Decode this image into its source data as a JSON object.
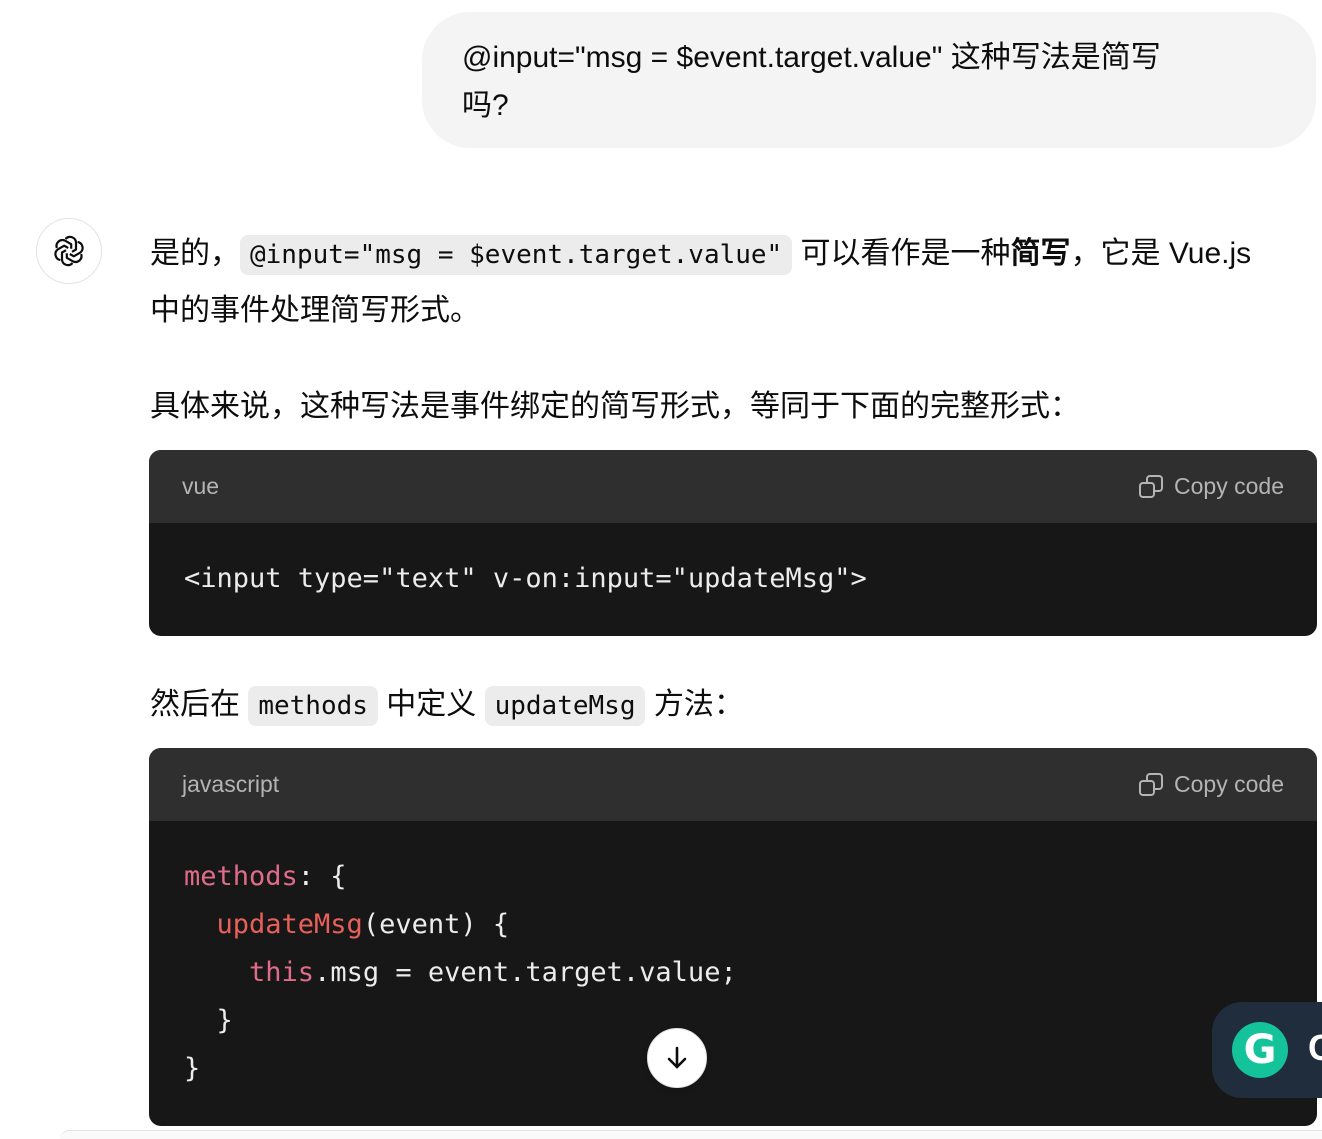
{
  "user_message": {
    "line1": "@input=\"msg = $event.target.value\" 这种写法是简写",
    "line2": "吗?"
  },
  "assistant": {
    "avatar_icon": "openai-logo-icon",
    "p1": {
      "prefix": "是的，",
      "code": "@input=\"msg = $event.target.value\"",
      "mid": " 可以看作是一种",
      "bold": "简写",
      "suffix": "，它是 Vue.js 中的事件处理简写形式。"
    },
    "p2": "具体来说，这种写法是事件绑定的简写形式，等同于下面的完整形式：",
    "code_block_1": {
      "language": "vue",
      "copy_label": "Copy code",
      "code": "<input type=\"text\" v-on:input=\"updateMsg\">"
    },
    "p3": {
      "prefix": "然后在 ",
      "code1": "methods",
      "mid": " 中定义 ",
      "code2": "updateMsg",
      "suffix": " 方法："
    },
    "code_block_2": {
      "language": "javascript",
      "copy_label": "Copy code",
      "lines": {
        "l1_kw": "methods",
        "l1_rest": ": {",
        "l2_indent": "  ",
        "l2_fn": "updateMsg",
        "l2_rest": "(event) {",
        "l3_indent": "    ",
        "l3_kw": "this",
        "l3_rest": ".msg = event.target.value;",
        "l4": "  }",
        "l5": "}"
      }
    }
  },
  "scroll_down_icon": "arrow-down-icon",
  "grammarly": {
    "icon": "grammarly-g-icon",
    "logo_letter": "G",
    "cut_off_text": "C"
  },
  "colors": {
    "code_bg": "#171717",
    "code_header_bg": "#2f2f2f",
    "keyword": "#e06c8b",
    "function": "#e9605a",
    "user_bubble": "#f4f4f4"
  }
}
